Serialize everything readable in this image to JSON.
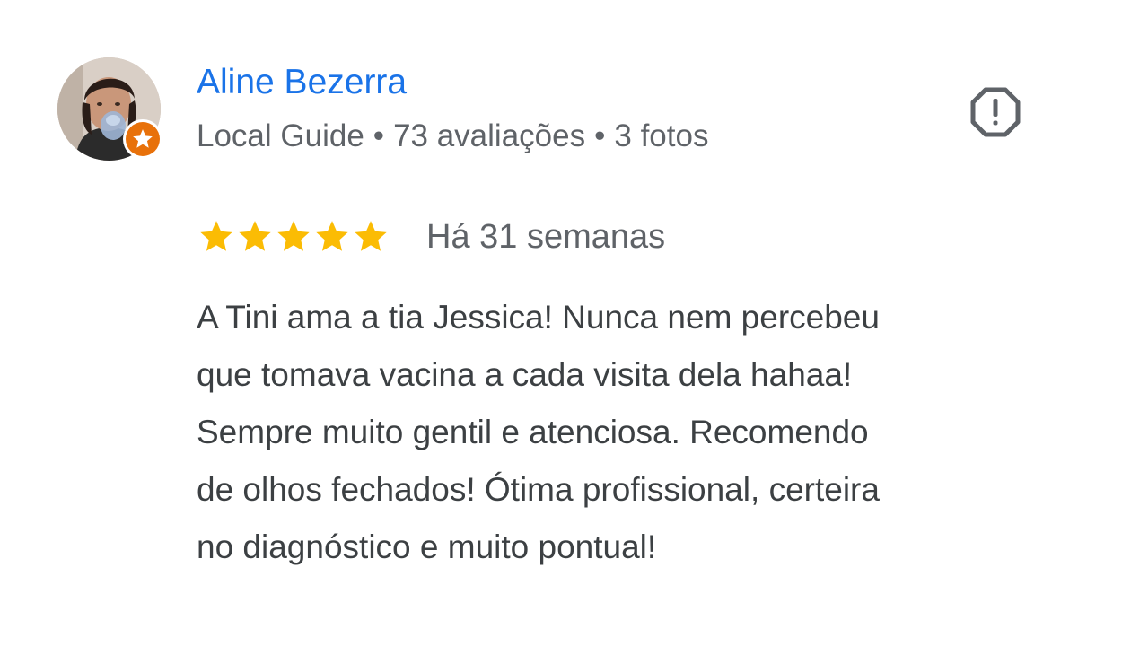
{
  "author": {
    "name": "Aline Bezerra",
    "meta": {
      "badge": "Local Guide",
      "separator": "•",
      "reviews": "73 avaliações",
      "photos": "3 fotos"
    },
    "avatar_icon": "user-photo",
    "badge_icon": "star-icon"
  },
  "report_icon": "report-flag-icon",
  "rating": {
    "stars": 5,
    "max": 5,
    "time": "Há 31 semanas"
  },
  "review": {
    "lines": [
      "A Tini ama a tia Jessica! Nunca nem percebeu",
      "que tomava vacina a cada visita dela hahaa!",
      "Sempre muito gentil e atenciosa. Recomendo",
      "de olhos fechados! Ótima profissional, certeira",
      "no diagnóstico e muito pontual!"
    ]
  },
  "colors": {
    "name": "#1a73e8",
    "meta": "#5f6368",
    "text": "#3c4043",
    "star": "#fbbc04",
    "badge": "#e8710a",
    "icon": "#5f6368"
  }
}
